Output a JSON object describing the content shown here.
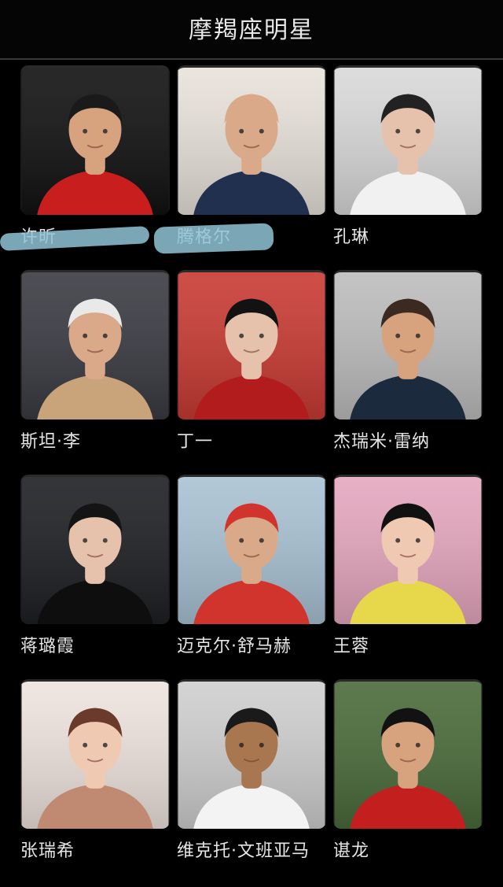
{
  "header": {
    "title": "摩羯座明星"
  },
  "celebrities": [
    {
      "name": "许昕",
      "photo": "man-red-shirt-portrait",
      "bg": "#111111",
      "skin": "#d7a27e",
      "hair": "#1a1a1a",
      "cloth": "#c81e1e"
    },
    {
      "name": "腾格尔",
      "photo": "bald-man-navy-suit-portrait",
      "bg": "#e8e2da",
      "skin": "#d9a98a",
      "hair": "#d9a98a",
      "cloth": "#22304f"
    },
    {
      "name": "孔琳",
      "photo": "woman-white-dress-portrait",
      "bg": "#d9d9d9",
      "skin": "#e6c2ac",
      "hair": "#222222",
      "cloth": "#f1f1f1"
    },
    {
      "name": "斯坦·李",
      "photo": "elderly-man-sunglasses-portrait",
      "bg": "#3a3a42",
      "skin": "#d9a98a",
      "hair": "#e9e9e9",
      "cloth": "#c9a37a"
    },
    {
      "name": "丁一",
      "photo": "young-man-red-background-portrait",
      "bg": "#c93a33",
      "skin": "#e6c2ac",
      "hair": "#121212",
      "cloth": "#b21c1c"
    },
    {
      "name": "杰瑞米·雷纳",
      "photo": "man-dark-sweater-portrait",
      "bg": "#bdbdbd",
      "skin": "#d7a27e",
      "hair": "#3a2a22",
      "cloth": "#1c2a3d"
    },
    {
      "name": "蒋璐霞",
      "photo": "woman-black-jacket-portrait",
      "bg": "#1d1f22",
      "skin": "#e6c2ac",
      "hair": "#141414",
      "cloth": "#0e0e0e"
    },
    {
      "name": "迈克尔·舒马赫",
      "photo": "racing-driver-red-suit-portrait",
      "bg": "#a9c2d3",
      "skin": "#d9a98a",
      "hair": "#d0342c",
      "cloth": "#d0342c"
    },
    {
      "name": "王蓉",
      "photo": "woman-pink-background-portrait",
      "bg": "#e6a7bf",
      "skin": "#f0c9b2",
      "hair": "#111111",
      "cloth": "#e7d74a"
    },
    {
      "name": "张瑞希",
      "photo": "woman-long-hair-portrait",
      "bg": "#efe4de",
      "skin": "#f0c9b2",
      "hair": "#6a3a2a",
      "cloth": "#c08a72"
    },
    {
      "name": "维克托·文班亚马",
      "photo": "basketball-player-jersey-portrait",
      "bg": "#cfcfcf",
      "skin": "#a9774f",
      "hair": "#1a1a1a",
      "cloth": "#f3f3f3"
    },
    {
      "name": "谌龙",
      "photo": "athlete-medal-portrait",
      "bg": "#4a6b3a",
      "skin": "#d7a27e",
      "hair": "#121212",
      "cloth": "#c41f1f"
    }
  ]
}
